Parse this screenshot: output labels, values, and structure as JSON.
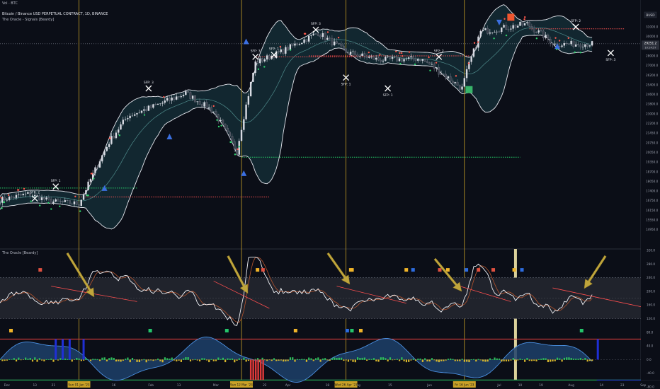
{
  "header": {
    "vol_label": "Vol · BTC",
    "title": "Bitcoin / Binance USD PERPETUAL CONTRACT, 1D, BINANCE",
    "indicator": "The Oracle - Signals [Beardy]",
    "lower_indicator": "The Oracle [Beardy]"
  },
  "price_scale": {
    "currency": "BUSD",
    "current_price": "29251.2",
    "countdown": "10:14:57",
    "ticks": [
      "31000.0",
      "30000.0",
      "29000.0",
      "28000.0",
      "27000.0",
      "26200.0",
      "25400.0",
      "24600.0",
      "23800.0",
      "23000.0",
      "22200.0",
      "21450.0",
      "20750.0",
      "20050.0",
      "19350.0",
      "18700.0",
      "18050.0",
      "17400.0",
      "16750.0",
      "16150.0",
      "15550.0",
      "14950.0"
    ]
  },
  "osc_scale": {
    "ticks": [
      "320.0",
      "280.0",
      "240.0",
      "200.0",
      "160.0",
      "120.0",
      "80.0",
      "40.0",
      "0.0",
      "-40.0",
      "-80.0"
    ]
  },
  "time_axis": {
    "ticks": [
      "Dec",
      "13",
      "21",
      "2023",
      "16",
      "Feb",
      "13",
      "Mar",
      "13",
      "22",
      "Apr",
      "18",
      "May",
      "15",
      "Jun",
      "19",
      "Jul",
      "10",
      "19",
      "Aug",
      "14",
      "23",
      "Sep"
    ],
    "highlights": [
      "Sun 01 Jan '23",
      "Sun 12 Mar '23",
      "Wed 26 Apr '23",
      "Fri 16 Jun '23"
    ]
  },
  "signals": {
    "sfp_labels": [
      "SFP: 2",
      "SFP: 1",
      "SFP: 3",
      "SFP: 3",
      "SFP: 1",
      "SFP: 3",
      "SFP: 1",
      "SFP: 1",
      "SFP: 2",
      "SFP: 3",
      "SFP: 2"
    ],
    "small_labels": [
      "Bull",
      "Bull",
      "Sell",
      "Bull",
      "Buy",
      "Bull",
      "Sell",
      "Bull",
      "Bull"
    ],
    "ema_labels": [
      "Exit",
      "Bull"
    ]
  },
  "chart_data": {
    "type": "candlestick",
    "title": "Bitcoin / Binance USD PERPETUAL CONTRACT, 1D, BINANCE",
    "xlabel": "",
    "ylabel": "",
    "x_range": [
      "2022-11-28",
      "2023-08-31"
    ],
    "ylim": [
      14950,
      31500
    ],
    "price_path": [
      {
        "date": "2022-11-28",
        "close": 16800
      },
      {
        "date": "2022-12-10",
        "close": 17200
      },
      {
        "date": "2022-12-20",
        "close": 16700
      },
      {
        "date": "2023-01-01",
        "close": 16550
      },
      {
        "date": "2023-01-14",
        "close": 20800
      },
      {
        "date": "2023-01-22",
        "close": 22800
      },
      {
        "date": "2023-02-02",
        "close": 23600
      },
      {
        "date": "2023-02-16",
        "close": 24700
      },
      {
        "date": "2023-02-28",
        "close": 23200
      },
      {
        "date": "2023-03-10",
        "close": 20100
      },
      {
        "date": "2023-03-18",
        "close": 27300
      },
      {
        "date": "2023-03-29",
        "close": 28400
      },
      {
        "date": "2023-04-14",
        "close": 30400
      },
      {
        "date": "2023-04-26",
        "close": 28400
      },
      {
        "date": "2023-05-10",
        "close": 27600
      },
      {
        "date": "2023-05-28",
        "close": 27700
      },
      {
        "date": "2023-06-15",
        "close": 25100
      },
      {
        "date": "2023-06-23",
        "close": 30500
      },
      {
        "date": "2023-07-13",
        "close": 31300
      },
      {
        "date": "2023-07-25",
        "close": 29200
      },
      {
        "date": "2023-08-08",
        "close": 29250
      }
    ],
    "oscillator": {
      "name": "The Oracle [Beardy]",
      "band_upper": 240,
      "band_lower": 120,
      "midline": 180
    },
    "grid": false
  }
}
